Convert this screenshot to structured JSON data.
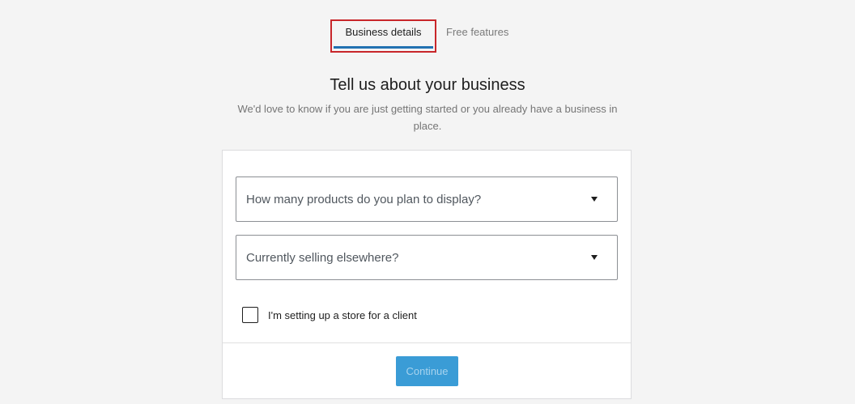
{
  "tabs": [
    {
      "label": "Business details",
      "active": true
    },
    {
      "label": "Free features",
      "active": false
    }
  ],
  "heading": "Tell us about your business",
  "subheading": "We'd love to know if you are just getting started or you already have a business in place.",
  "form": {
    "products_select": {
      "placeholder": "How many products do you plan to display?"
    },
    "selling_select": {
      "placeholder": "Currently selling elsewhere?"
    },
    "client_checkbox": {
      "label": "I'm setting up a store for a client",
      "checked": false
    },
    "continue_label": "Continue"
  },
  "colors": {
    "accent": "#2271b1",
    "button": "#3a9cd6",
    "highlight_box": "#c8262a"
  }
}
